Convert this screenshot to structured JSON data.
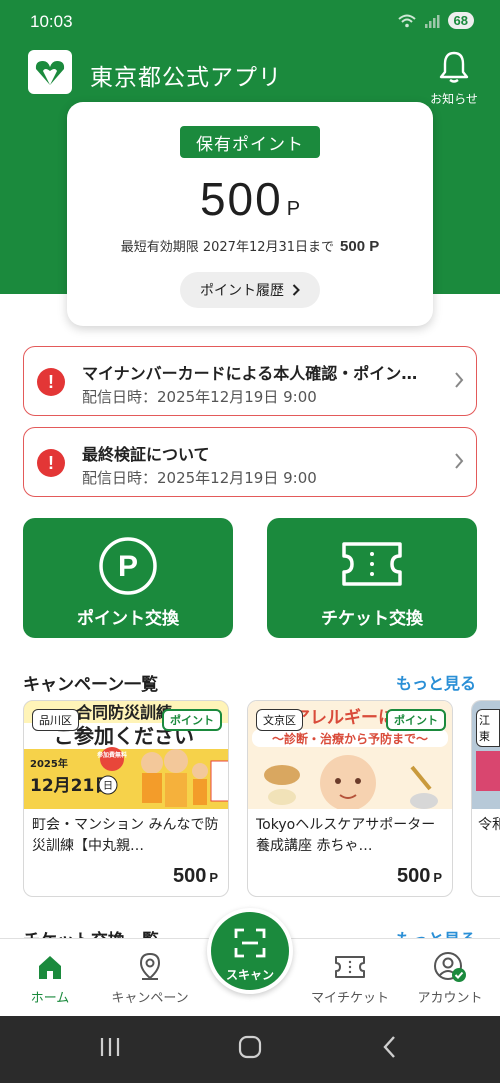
{
  "status_bar": {
    "time": "10:03",
    "battery": "68"
  },
  "header": {
    "app_title": "東京都公式アプリ",
    "notice_label": "お知らせ"
  },
  "points": {
    "badge": "保有ポイント",
    "value": "500",
    "unit": "P",
    "expiry_text": "最短有効期限 2027年12月31日まで",
    "expiry_points": "500 P",
    "history_button": "ポイント履歴"
  },
  "alerts": [
    {
      "title": "マイナンバーカードによる本人確認・ポイン…",
      "date": "配信日時：2025年12月19日 9:00"
    },
    {
      "title": "最終検証について",
      "date": "配信日時：2025年12月19日 9:00"
    }
  ],
  "tiles": {
    "point_exchange": "ポイント交換",
    "ticket_exchange": "チケット交換"
  },
  "campaigns": {
    "section_title": "キャンペーン一覧",
    "more": "もっと見る",
    "items": [
      {
        "area": "品川区",
        "badge": "ポイント",
        "banner_title": "ご参加ください",
        "banner_top": "合同防災訓練",
        "banner_year": "2025年",
        "banner_date": "12月21日",
        "banner_weekday": "日",
        "banner_free": "参加費無料",
        "title": "町会・マンション みんなで防災訓練【中丸親…",
        "price": "500",
        "unit": "P"
      },
      {
        "area": "文京区",
        "badge": "ポイント",
        "banner_title": "アレルギーに",
        "banner_sub": "〜診断・治療から予防まで〜",
        "title": "Tokyoヘルスケアサポーター養成講座 赤ちゃ…",
        "price": "500",
        "unit": "P"
      },
      {
        "area": "江東",
        "title": "令和"
      }
    ]
  },
  "tickets": {
    "section_title": "チケット交換一覧",
    "more": "もっと見る"
  },
  "bottom_nav": {
    "home": "ホーム",
    "campaign": "キャンペーン",
    "scan": "スキャン",
    "my_ticket": "マイチケット",
    "account": "アカウント"
  },
  "colors": {
    "brand_green": "#1b8a3d",
    "alert_red": "#e33636",
    "link_blue": "#2a8fd6"
  }
}
